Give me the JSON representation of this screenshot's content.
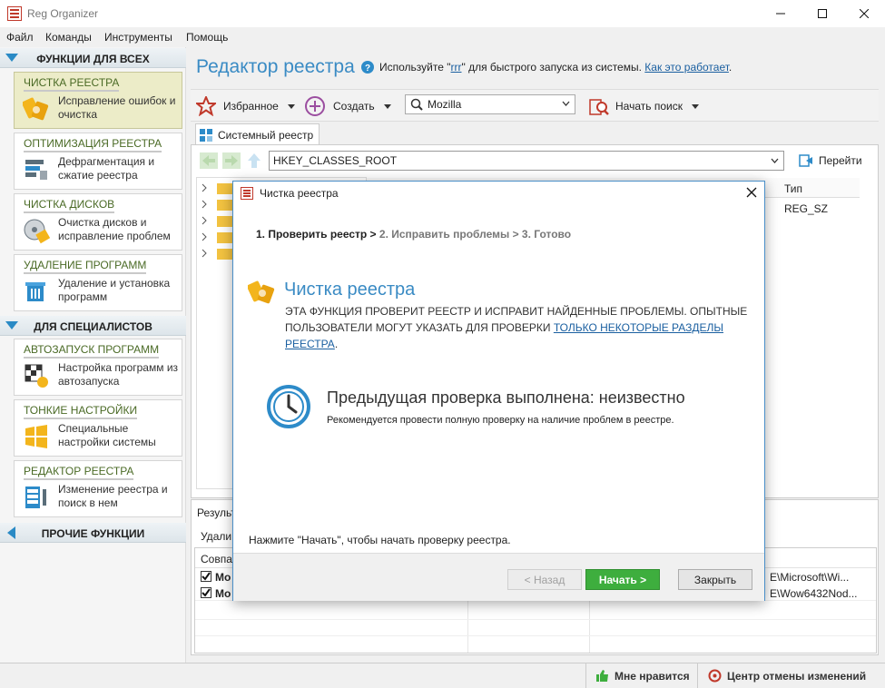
{
  "window": {
    "title": "Reg Organizer"
  },
  "menu": [
    "Файл",
    "Команды",
    "Инструменты",
    "Помощь"
  ],
  "sidebar": {
    "section_all": "ФУНКЦИИ ДЛЯ ВСЕХ",
    "section_pro": "ДЛЯ СПЕЦИАЛИСТОВ",
    "section_other": "ПРОЧИЕ ФУНКЦИИ",
    "items": [
      {
        "title": "ЧИСТКА РЕЕСТРА",
        "desc": "Исправление ошибок и очистка",
        "icon": "registry-clean-icon",
        "active": true
      },
      {
        "title": "ОПТИМИЗАЦИЯ РЕЕСТРА",
        "desc": "Дефрагментация и сжатие реестра",
        "icon": "registry-optimize-icon"
      },
      {
        "title": "ЧИСТКА ДИСКОВ",
        "desc": "Очистка дисков и исправление проблем",
        "icon": "disk-clean-icon"
      },
      {
        "title": "УДАЛЕНИЕ ПРОГРАММ",
        "desc": "Удаление и установка программ",
        "icon": "uninstall-icon"
      },
      {
        "title": "АВТОЗАПУСК ПРОГРАММ",
        "desc": "Настройка программ из автозапуска",
        "icon": "autostart-icon"
      },
      {
        "title": "ТОНКИЕ НАСТРОЙКИ",
        "desc": "Специальные настройки системы",
        "icon": "tweaks-icon"
      },
      {
        "title": "РЕДАКТОР РЕЕСТРА",
        "desc": "Изменение реестра и поиск в нем",
        "icon": "registry-editor-icon"
      }
    ]
  },
  "main": {
    "title": "Редактор реестра",
    "hint_prefix": "Используйте \"",
    "hint_cmd": "rrr",
    "hint_suffix": "\" для быстрого запуска из системы.",
    "hint_link": "Как это работает",
    "hint_end": ".",
    "toolbar": {
      "favorites": "Избранное",
      "create": "Создать",
      "search_value": "Mozilla",
      "start_search": "Начать поиск"
    },
    "tab": "Системный реестр",
    "address": "HKEY_CLASSES_ROOT",
    "go": "Перейти",
    "grid_col_type": "Тип",
    "grid_row_type": "REG_SZ",
    "results_tab": "Результ",
    "results_delete": "Удали",
    "results_col": "Совпа",
    "results_rows": [
      {
        "name": "Mo",
        "path": "E\\Microsoft\\Wi..."
      },
      {
        "name": "Mo",
        "path": "E\\Wow6432Nod..."
      }
    ]
  },
  "status": {
    "like": "Мне нравится",
    "undo_center": "Центр отмены изменений"
  },
  "modal": {
    "title": "Чистка реестра",
    "steps_current": "1. Проверить реестр >",
    "steps_rest": " 2. Исправить проблемы > 3. Готово",
    "heading": "Чистка реестра",
    "desc": "ЭТА ФУНКЦИЯ ПРОВЕРИТ РЕЕСТР И ИСПРАВИТ НАЙДЕННЫЕ ПРОБЛЕМЫ. ОПЫТНЫЕ ПОЛЬЗОВАТЕЛИ МОГУТ УКАЗАТЬ ДЛЯ ПРОВЕРКИ ",
    "desc_link": "ТОЛЬКО НЕКОТОРЫЕ РАЗДЕЛЫ РЕЕСТРА",
    "desc_end": ".",
    "last_check": "Предыдущая проверка выполнена: неизвестно",
    "recommend": "Рекомендуется провести полную проверку на наличие проблем в реестре.",
    "press_start": "Нажмите \"Начать\", чтобы начать проверку реестра.",
    "btn_back": "< Назад",
    "btn_start": "Начать >",
    "btn_close": "Закрыть"
  },
  "colors": {
    "accent": "#3a8bc4",
    "start_button": "#3eae3e"
  }
}
